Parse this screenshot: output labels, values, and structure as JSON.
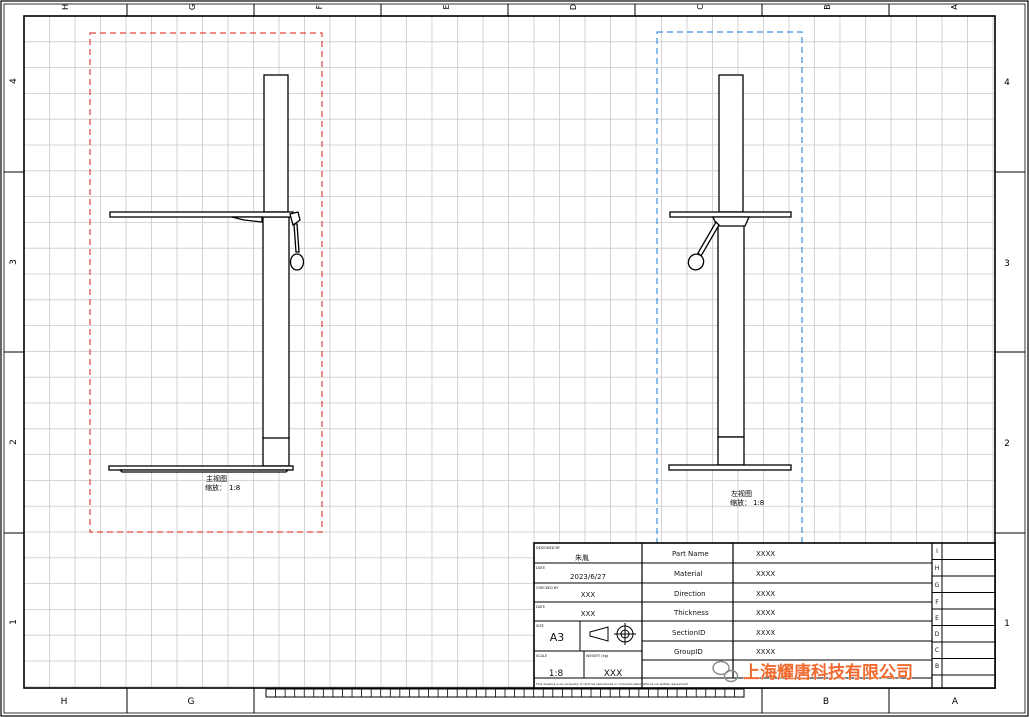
{
  "border": {
    "top_zones": [
      "H",
      "G",
      "F",
      "E",
      "D",
      "C",
      "B",
      "A"
    ],
    "bottom_zones": [
      "H",
      "G",
      "B",
      "A"
    ],
    "side_rows": [
      "4",
      "3",
      "2",
      "1"
    ]
  },
  "views": {
    "front": {
      "title": "主视图",
      "scale_label": "缩放：",
      "scale_value": "1:8",
      "frame_color": "#e0443a"
    },
    "side": {
      "title": "左视图",
      "scale_label": "缩放：",
      "scale_value": "1:8",
      "frame_color": "#3f8fe0"
    }
  },
  "title_block": {
    "left_fields": [
      {
        "label": "DESIGNED BY",
        "value": "朱胤"
      },
      {
        "label": "DATE",
        "value": "2023/6/27"
      },
      {
        "label": "CHECKED BY",
        "value": "XXX"
      },
      {
        "label": "DATE",
        "value": "XXX"
      }
    ],
    "size_label": "SIZE",
    "size": "A3",
    "scale_label": "SCALE",
    "scale": "1:8",
    "weight_label": "WEIGHT (kg)",
    "weight": "XXX",
    "properties": [
      {
        "key": "Part Name",
        "value": "XXXX"
      },
      {
        "key": "Material",
        "value": "XXXX"
      },
      {
        "key": "Direction",
        "value": "XXXX"
      },
      {
        "key": "Thickness",
        "value": "XXXX"
      },
      {
        "key": "SectionID",
        "value": "XXXX"
      },
      {
        "key": "GroupID",
        "value": "XXXX"
      }
    ],
    "revision_letters": [
      "I",
      "H",
      "G",
      "F",
      "E",
      "D",
      "C",
      "B"
    ],
    "footer_note": "This drawing is our property; it can't be reproduced or communicated without our written agreement."
  },
  "watermark": {
    "text": "上海耀唐科技有限公司",
    "icon": "wechat-icon"
  },
  "colors": {
    "grid": "#c9c9c9",
    "line": "#000000",
    "watermark": "#f06a2f"
  }
}
